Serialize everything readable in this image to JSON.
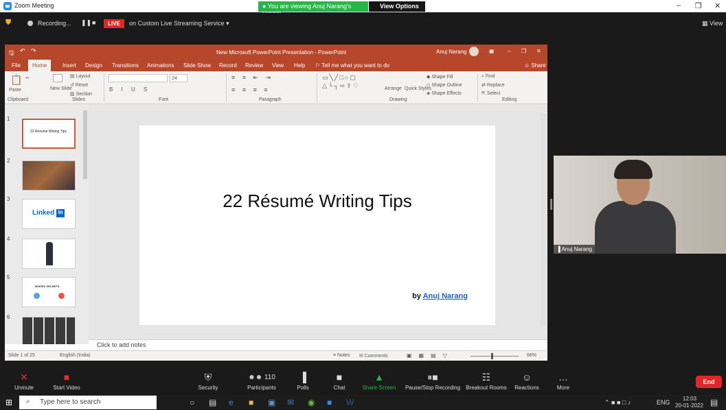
{
  "zoom_titlebar": {
    "title": "Zoom Meeting",
    "viewing_banner": "You are viewing Anuj Narang's screen",
    "view_options": "View Options"
  },
  "zoom_top": {
    "recording": "Recording...",
    "live": "LIVE",
    "stream": "on Custom Live Streaming Service",
    "view": "View"
  },
  "ppt": {
    "window_title": "New Microsoft PowerPoint Presentation  -  PowerPoint",
    "user": "Anuj Narang",
    "tabs": [
      "File",
      "Home",
      "Insert",
      "Design",
      "Transitions",
      "Animations",
      "Slide Show",
      "Record",
      "Review",
      "View",
      "Help"
    ],
    "tell_me": "Tell me what you want to do",
    "share": "Share",
    "ribbon": {
      "paste": "Paste",
      "new_slide": "New Slide",
      "layout": "Layout",
      "reset": "Reset",
      "section": "Section",
      "font_size": "24",
      "arrange": "Arrange",
      "quick_styles": "Quick Styles",
      "shape_fill": "Shape Fill",
      "shape_outline": "Shape Outline",
      "shape_effects": "Shape Effects",
      "find": "Find",
      "replace": "Replace",
      "select": "Select",
      "groups": [
        "Clipboard",
        "Slides",
        "Font",
        "Paragraph",
        "Drawing",
        "Editing"
      ]
    },
    "thumbs": [
      {
        "num": "1",
        "label": "22 Résumé Writing Tips"
      },
      {
        "num": "2",
        "label": ""
      },
      {
        "num": "3",
        "label": "Linked"
      },
      {
        "num": "4",
        "label": ""
      },
      {
        "num": "5",
        "label": "MISSED HELMETS"
      },
      {
        "num": "6",
        "label": ""
      }
    ],
    "slide_title": "22 Résumé Writing Tips",
    "slide_by": "by",
    "slide_author": "Anuj Narang",
    "notes_placeholder": "Click to add notes",
    "status": {
      "slide": "Slide 1 of 25",
      "language": "English (India)",
      "notes": "Notes",
      "comments": "Comments",
      "zoom": "66%"
    }
  },
  "video": {
    "name": "Anuj Narang"
  },
  "zoom_controls": [
    {
      "label": "Unmute",
      "icon": "mic-muted-icon"
    },
    {
      "label": "Start Video",
      "icon": "video-off-icon"
    },
    {
      "label": "Security",
      "icon": "shield-icon"
    },
    {
      "label": "Participants",
      "icon": "participants-icon",
      "count": "110"
    },
    {
      "label": "Polls",
      "icon": "polls-icon"
    },
    {
      "label": "Chat",
      "icon": "chat-icon"
    },
    {
      "label": "Share Screen",
      "icon": "share-screen-icon"
    },
    {
      "label": "Pause/Stop Recording",
      "icon": "pause-recording-icon"
    },
    {
      "label": "Breakout Rooms",
      "icon": "breakout-icon"
    },
    {
      "label": "Reactions",
      "icon": "reactions-icon"
    },
    {
      "label": "More",
      "icon": "more-icon"
    }
  ],
  "end_label": "End",
  "taskbar": {
    "search": "Type here to search",
    "lang": "ENG",
    "time": "12:03",
    "date": "20-01-2022"
  },
  "colors": {
    "ppt_accent": "#b7472a",
    "zoom_dark": "#1a1a1a",
    "zoom_green": "#26b64a",
    "live_red": "#e02828"
  }
}
